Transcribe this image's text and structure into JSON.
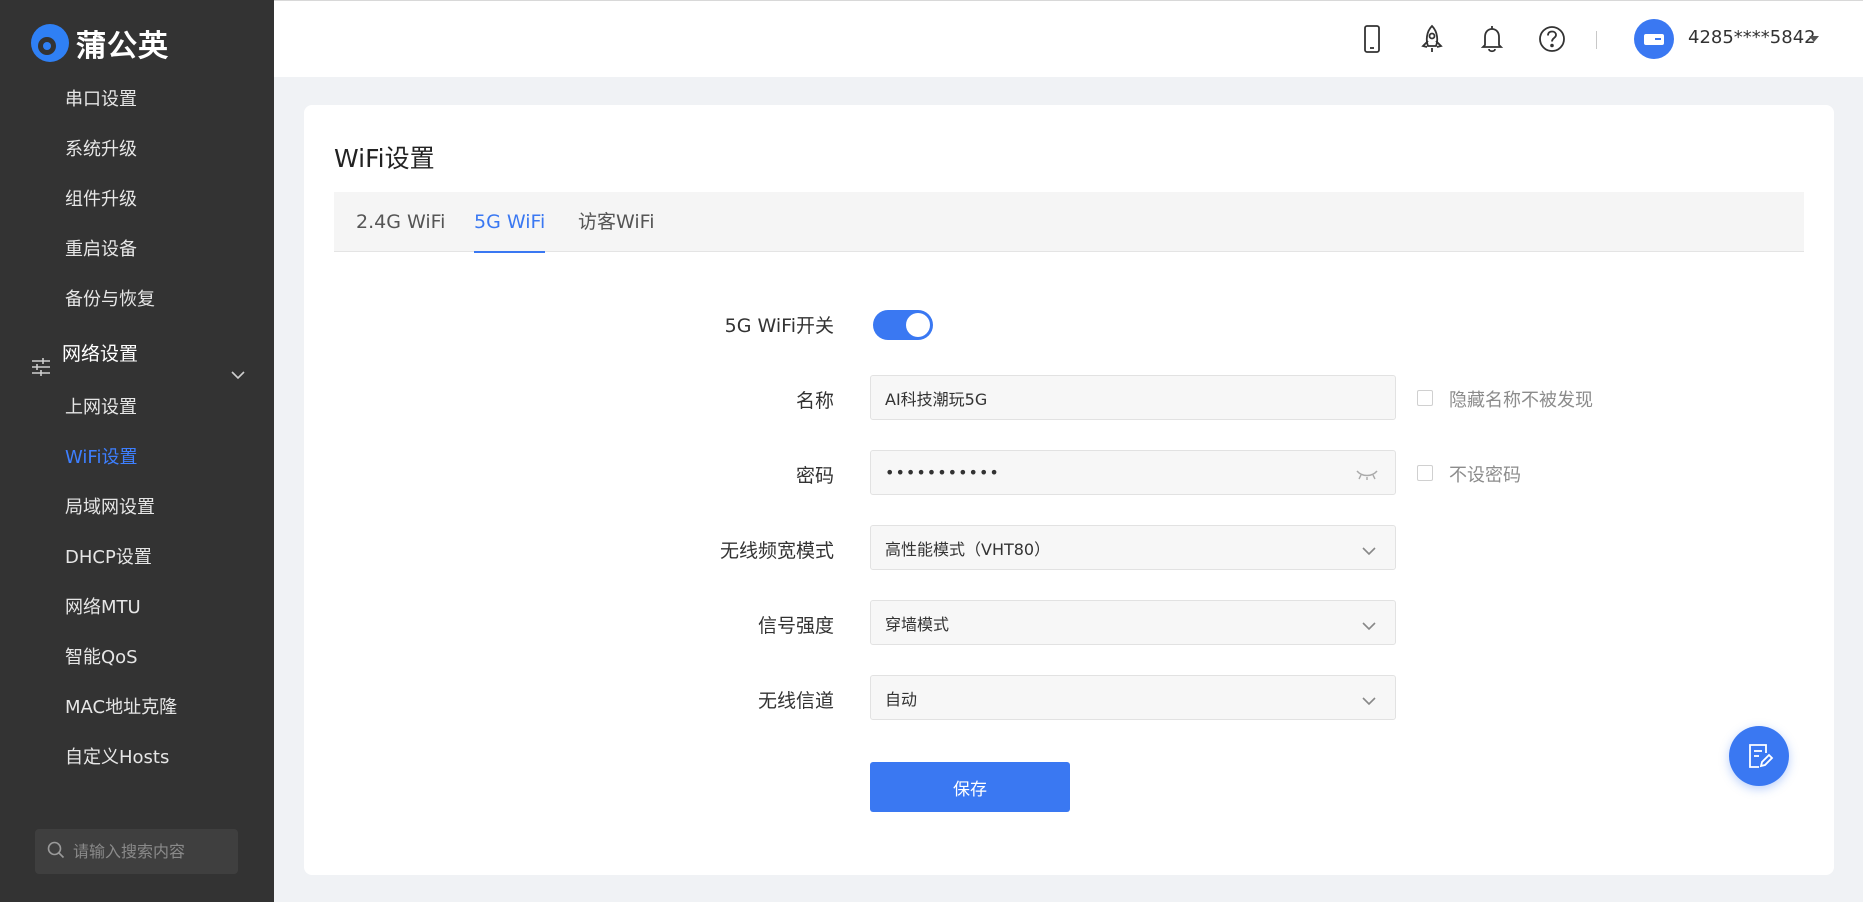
{
  "brand": {
    "name": "蒲公英",
    "accent": "#3a78f2"
  },
  "sidebar": {
    "items_top": [
      {
        "label": "串口设置"
      },
      {
        "label": "系统升级"
      },
      {
        "label": "组件升级"
      },
      {
        "label": "重启设备"
      },
      {
        "label": "备份与恢复"
      }
    ],
    "group": {
      "label": "网络设置",
      "icon": "sliders-icon",
      "expanded": true
    },
    "items_group": [
      {
        "label": "上网设置"
      },
      {
        "label": "WiFi设置",
        "active": true
      },
      {
        "label": "局域网设置"
      },
      {
        "label": "DHCP设置"
      },
      {
        "label": "网络MTU"
      },
      {
        "label": "智能QoS"
      },
      {
        "label": "MAC地址克隆"
      },
      {
        "label": "自定义Hosts"
      }
    ],
    "search": {
      "placeholder": "请输入搜索内容"
    }
  },
  "header": {
    "icons": [
      "mobile-icon",
      "rocket-icon",
      "bell-icon",
      "help-icon"
    ],
    "username": "4285****5842"
  },
  "page": {
    "title": "WiFi设置",
    "tabs": [
      {
        "label": "2.4G WiFi"
      },
      {
        "label": "5G WiFi",
        "active": true
      },
      {
        "label": "访客WiFi"
      }
    ],
    "form": {
      "switch_label": "5G WiFi开关",
      "switch_on": true,
      "name_label": "名称",
      "name_value": "AI科技潮玩5G",
      "hide_name_label": "隐藏名称不被发现",
      "password_label": "密码",
      "password_value": "•••••••••••",
      "no_password_label": "不设密码",
      "bandwidth_label": "无线频宽模式",
      "bandwidth_value": "高性能模式（VHT80）",
      "signal_label": "信号强度",
      "signal_value": "穿墙模式",
      "channel_label": "无线信道",
      "channel_value": "自动",
      "save_label": "保存"
    }
  }
}
